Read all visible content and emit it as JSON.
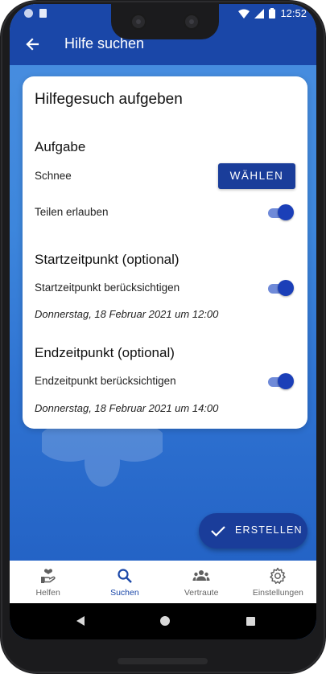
{
  "status_bar": {
    "time": "12:52"
  },
  "app_bar": {
    "title": "Hilfe suchen",
    "back_icon": "arrow-back-icon"
  },
  "card": {
    "title": "Hilfegesuch aufgeben",
    "task": {
      "heading": "Aufgabe",
      "value": "Schnee",
      "choose_button": "WÄHLEN",
      "share_label": "Teilen erlauben",
      "share_enabled": true
    },
    "start": {
      "heading": "Startzeitpunkt (optional)",
      "toggle_label": "Startzeitpunkt berücksichtigen",
      "enabled": true,
      "date": "Donnerstag, 18 Februar 2021 um 12:00"
    },
    "end": {
      "heading": "Endzeitpunkt (optional)",
      "toggle_label": "Endzeitpunkt berücksichtigen",
      "enabled": true,
      "date": "Donnerstag, 18 Februar 2021 um 14:00"
    }
  },
  "fab": {
    "label": "ERSTELLEN",
    "icon": "check-icon"
  },
  "bottom_nav": {
    "items": [
      {
        "label": "Helfen",
        "icon": "helping-hand-icon",
        "active": false
      },
      {
        "label": "Suchen",
        "icon": "search-icon",
        "active": true
      },
      {
        "label": "Vertraute",
        "icon": "people-icon",
        "active": false
      },
      {
        "label": "Einstellungen",
        "icon": "gear-icon",
        "active": false
      }
    ]
  },
  "colors": {
    "primary": "#1a47a8",
    "button": "#1a3d9a",
    "switch_thumb": "#1b3fb8",
    "switch_track": "#6f8ad8"
  }
}
